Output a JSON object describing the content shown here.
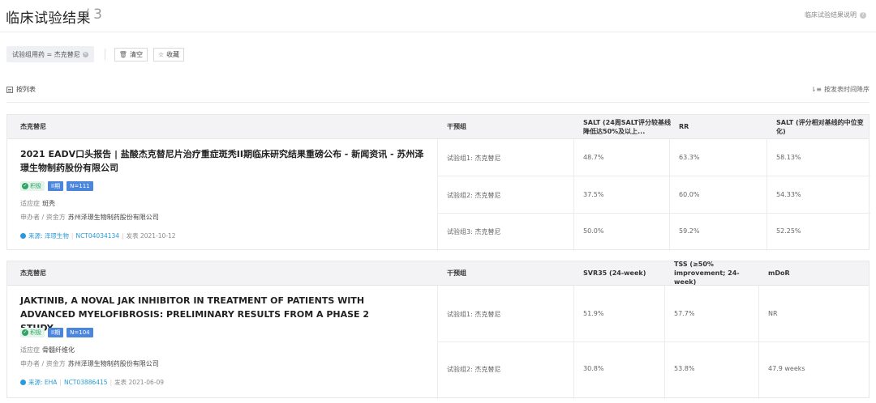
{
  "header": {
    "title": "临床试验结果",
    "count": "/ 3",
    "help": "临床试验结果说明"
  },
  "filters": {
    "chip": "试验组用药 = 杰克替尼",
    "clear": "清空",
    "favorite": "收藏"
  },
  "listbar": {
    "view": "按列表",
    "sort": "按发表时间降序"
  },
  "cards": [
    {
      "drug": "杰克替尼",
      "intervention_header": "干预组",
      "metric_headers": [
        "SALT (24周SALT评分较基线降低达50%及以上...",
        "RR",
        "SALT (评分相对基线的中位变化)"
      ],
      "title": "2021 EADV口头报告 | 盐酸杰克替尼片治疗重症斑秃II期临床研究结果重磅公布 - 新闻资讯 - 苏州泽璟生物制药股份有限公司",
      "badges": {
        "status": "积极",
        "phase": "II期",
        "n": "N=111"
      },
      "indication_label": "适应症",
      "indication": "斑秃",
      "sponsor_label": "申办者 / 资金方",
      "sponsor": "苏州泽璟生物制药股份有限公司",
      "source": "来源: 泽璟生物",
      "nct": "NCT04034134",
      "published": "发表 2021-10-12",
      "rows": [
        {
          "group": "试验组1: 杰克替尼",
          "values": [
            "48.7%",
            "63.3%",
            "58.13%"
          ]
        },
        {
          "group": "试验组2: 杰克替尼",
          "values": [
            "37.5%",
            "60.0%",
            "54.33%"
          ]
        },
        {
          "group": "试验组3: 杰克替尼",
          "values": [
            "50.0%",
            "59.2%",
            "52.25%"
          ]
        }
      ]
    },
    {
      "drug": "杰克替尼",
      "intervention_header": "干预组",
      "metric_headers": [
        "SVR35 (24-week)",
        "TSS (≥50% improvement; 24-week)",
        "mDoR"
      ],
      "title": "JAKTINIB, A NOVAL JAK INHIBITOR IN TREATMENT OF PATIENTS WITH ADVANCED MYELOFIBROSIS: PRELIMINARY RESULTS FROM A PHASE 2 STUDY",
      "badges": {
        "status": "积极",
        "phase": "II期",
        "n": "N=104"
      },
      "indication_label": "适应症",
      "indication": "骨髓纤维化",
      "sponsor_label": "申办者 / 资金方",
      "sponsor": "苏州泽璟生物制药股份有限公司",
      "source": "来源: EHA",
      "nct": "NCT03886415",
      "published": "发表 2021-06-09",
      "rows": [
        {
          "group": "试验组1: 杰克替尼",
          "values": [
            "51.9%",
            "57.7%",
            "NR"
          ]
        },
        {
          "group": "试验组2: 杰克替尼",
          "values": [
            "30.8%",
            "53.8%",
            "47.9 weeks"
          ]
        }
      ]
    }
  ]
}
